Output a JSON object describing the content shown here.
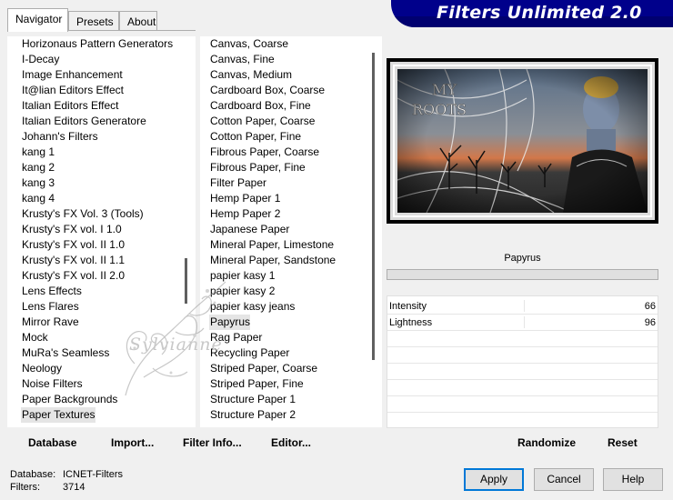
{
  "window": {
    "banner_title": "Filters Unlimited 2.0",
    "accent_color": "#00008b"
  },
  "tabs": [
    {
      "label": "Navigator",
      "active": true
    },
    {
      "label": "Presets",
      "active": false
    },
    {
      "label": "About",
      "active": false
    }
  ],
  "categories": {
    "items": [
      "Horizonaus Pattern Generators",
      "I-Decay",
      "Image Enhancement",
      "It@lian Editors Effect",
      "Italian Editors Effect",
      "Italian Editors Generatore",
      "Johann's Filters",
      "kang 1",
      "kang 2",
      "kang 3",
      "kang 4",
      "Krusty's FX Vol. 3 (Tools)",
      "Krusty's FX vol. I 1.0",
      "Krusty's FX vol. II 1.0",
      "Krusty's FX vol. II 1.1",
      "Krusty's FX vol. II 2.0",
      "Lens Effects",
      "Lens Flares",
      "Mirror Rave",
      "Mock",
      "MuRa's Seamless",
      "Neology",
      "Noise Filters",
      "Paper Backgrounds",
      "Paper Textures"
    ],
    "selected": "Paper Textures"
  },
  "filters": {
    "items": [
      "Canvas, Coarse",
      "Canvas, Fine",
      "Canvas, Medium",
      "Cardboard Box, Coarse",
      "Cardboard Box, Fine",
      "Cotton Paper, Coarse",
      "Cotton Paper, Fine",
      "Fibrous Paper, Coarse",
      "Fibrous Paper, Fine",
      "Filter Paper",
      "Hemp Paper 1",
      "Hemp Paper 2",
      "Japanese Paper",
      "Mineral Paper, Limestone",
      "Mineral Paper, Sandstone",
      "papier kasy 1",
      "papier kasy 2",
      "papier kasy jeans",
      "Papyrus",
      "Rag Paper",
      "Recycling Paper",
      "Striped Paper, Coarse",
      "Striped Paper, Fine",
      "Structure Paper 1",
      "Structure Paper 2"
    ],
    "selected": "Papyrus"
  },
  "preview": {
    "image_text": "MY ROOTS",
    "filter_name": "Papyrus"
  },
  "parameters": [
    {
      "label": "Intensity",
      "value": "66"
    },
    {
      "label": "Lightness",
      "value": "96"
    }
  ],
  "watermark": {
    "text": "Sylvianne"
  },
  "toolbar": {
    "database": "Database",
    "import": "Import...",
    "filter_info": "Filter Info...",
    "editor": "Editor...",
    "randomize": "Randomize",
    "reset": "Reset"
  },
  "status": {
    "database_label": "Database:",
    "database_value": "ICNET-Filters",
    "filters_label": "Filters:",
    "filters_value": "3714"
  },
  "buttons": {
    "apply": "Apply",
    "cancel": "Cancel",
    "help": "Help"
  }
}
